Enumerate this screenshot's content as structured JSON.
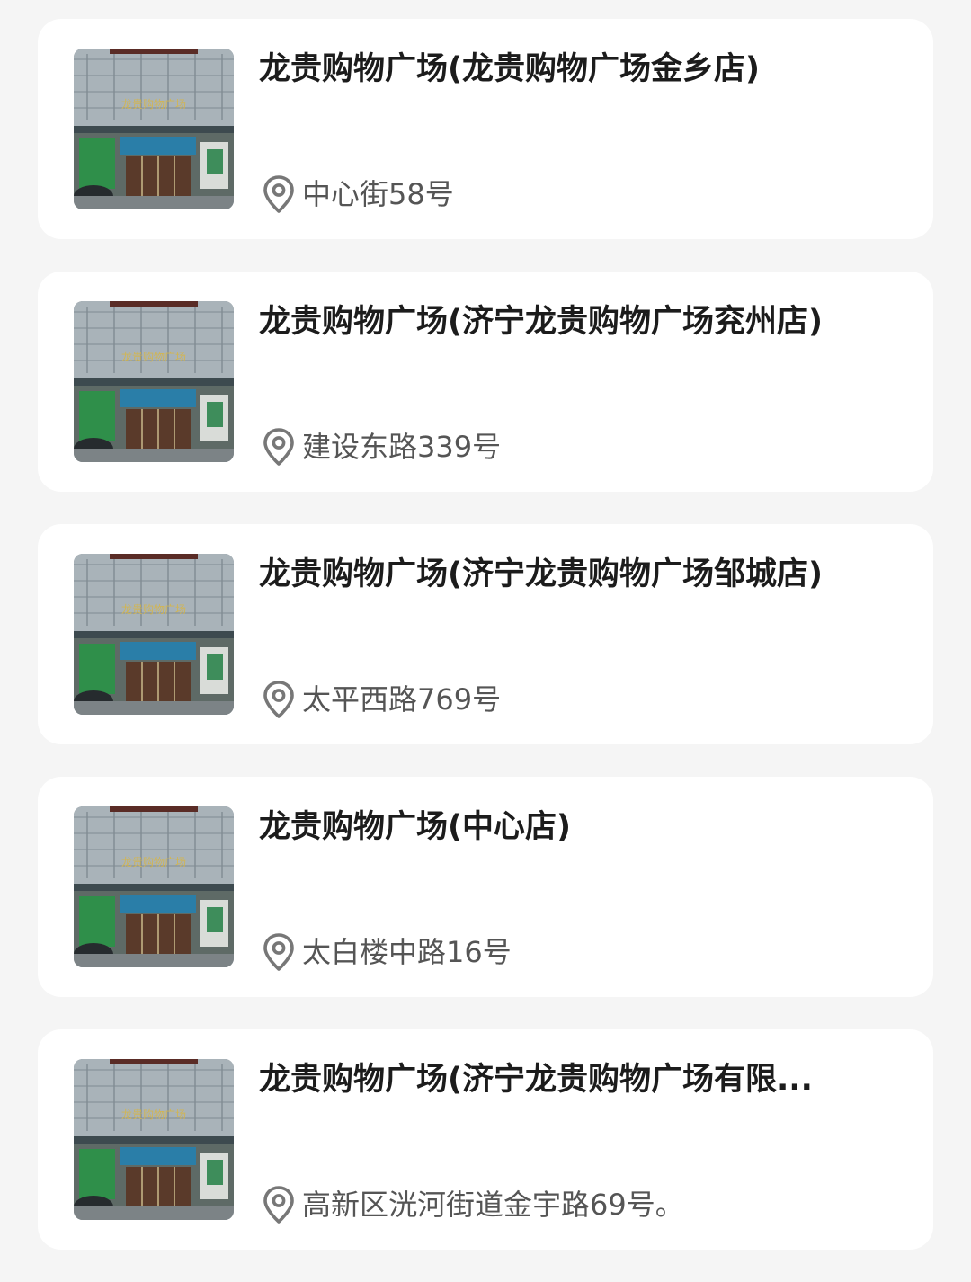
{
  "colors": {
    "page_background": "#f5f5f5",
    "card_background": "#ffffff",
    "title_text": "#1c1c1c",
    "address_text": "#555555",
    "pin_icon": "#777777"
  },
  "stores": [
    {
      "name": "龙贵购物广场(龙贵购物广场金乡店)",
      "address": "中心街58号",
      "thumbnail_sign": "龙贵购物广场",
      "icon": "location-pin-icon"
    },
    {
      "name": "龙贵购物广场(济宁龙贵购物广场兖州店)",
      "address": "建设东路339号",
      "thumbnail_sign": "龙贵购物广场",
      "icon": "location-pin-icon"
    },
    {
      "name": "龙贵购物广场(济宁龙贵购物广场邹城店)",
      "address": "太平西路769号",
      "thumbnail_sign": "龙贵购物广场",
      "icon": "location-pin-icon"
    },
    {
      "name": "龙贵购物广场(中心店)",
      "address": "太白楼中路16号",
      "thumbnail_sign": "龙贵购物广场",
      "icon": "location-pin-icon"
    },
    {
      "name": "龙贵购物广场(济宁龙贵购物广场有限...",
      "address": "高新区洸河街道金宇路69号。",
      "thumbnail_sign": "龙贵购物广场",
      "icon": "location-pin-icon"
    }
  ]
}
